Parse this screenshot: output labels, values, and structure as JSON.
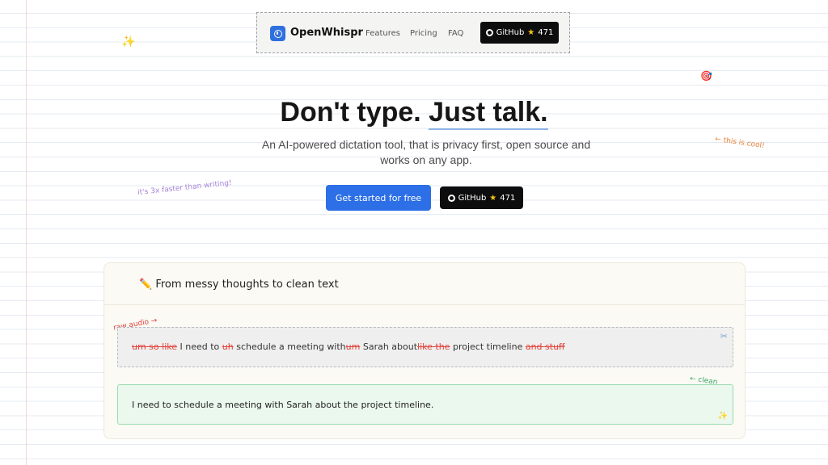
{
  "nav": {
    "brand": "OpenWhispr",
    "links": [
      "Features",
      "Pricing",
      "FAQ"
    ],
    "github_label": "GitHub",
    "github_stars": "471"
  },
  "decorations": {
    "sparkle": "✨",
    "target": "🎯",
    "this_is_cool": "← this is cool!",
    "faster": "it's 3x faster than writing!",
    "raw_audio": "raw audio →",
    "clean_output": "← clean output!"
  },
  "hero": {
    "title_part1": "Don't type. ",
    "title_part2": "Just talk.",
    "subtitle": "An AI-powered dictation tool, that is privacy first, open source and works on any app.",
    "cta_primary": "Get started for free",
    "cta_github_label": "GitHub",
    "cta_github_stars": "471"
  },
  "demo": {
    "heading_icon": "✏️",
    "heading": "From messy thoughts to clean text",
    "raw_segments": [
      {
        "text": "um so like",
        "strike": true
      },
      {
        "text": " I need to ",
        "strike": false
      },
      {
        "text": "uh",
        "strike": true
      },
      {
        "text": " schedule a meeting with",
        "strike": false
      },
      {
        "text": "um",
        "strike": true
      },
      {
        "text": " Sarah about",
        "strike": false
      },
      {
        "text": "like the",
        "strike": true
      },
      {
        "text": " project timeline ",
        "strike": false
      },
      {
        "text": "and stuff",
        "strike": true
      }
    ],
    "scissors_icon": "✂",
    "clean_text": "I need to schedule a meeting with Sarah about the project timeline.",
    "sparkle_icon": "✨"
  },
  "colors": {
    "primary": "#2c6fe6",
    "dark": "#0d0d0d",
    "strike": "#e0443c",
    "clean_border": "#9bdcb0",
    "note_orange": "#e8823a",
    "note_purple": "#a783d8",
    "note_green": "#3aa669"
  }
}
